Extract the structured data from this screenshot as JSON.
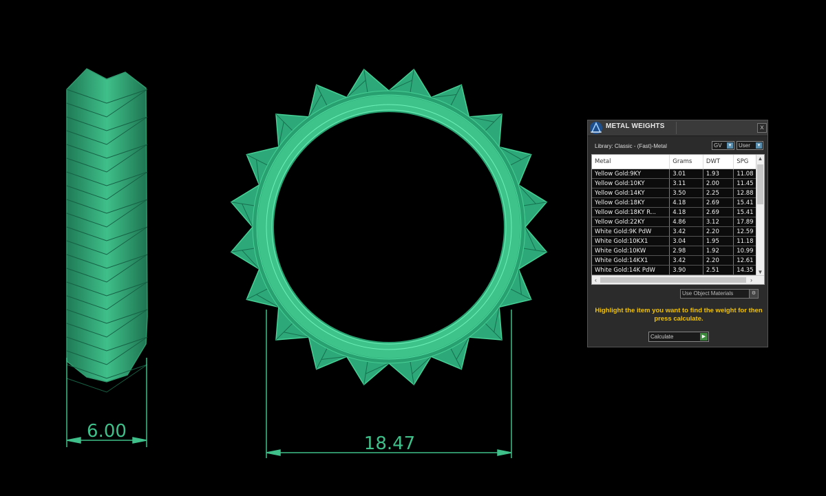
{
  "viewport": {
    "dimension_width_label": "6.00",
    "dimension_diameter_label": "18.47",
    "model_color": "#3fbf8a"
  },
  "panel": {
    "title": "METAL WEIGHTS",
    "close_label": "x",
    "library_label": "Library: Classic - (Fast)-Metal",
    "unit_select": "GV",
    "user_select": "User",
    "columns": [
      "Metal",
      "Grams",
      "DWT",
      "SPG"
    ],
    "rows": [
      [
        "Yellow Gold:9KY",
        "3.01",
        "1.93",
        "11.08"
      ],
      [
        "Yellow Gold:10KY",
        "3.11",
        "2.00",
        "11.45"
      ],
      [
        "Yellow Gold:14KY",
        "3.50",
        "2.25",
        "12.88"
      ],
      [
        "Yellow Gold:18KY",
        "4.18",
        "2.69",
        "15.41"
      ],
      [
        "Yellow Gold:18KY R...",
        "4.18",
        "2.69",
        "15.41"
      ],
      [
        "Yellow Gold:22KY",
        "4.86",
        "3.12",
        "17.89"
      ],
      [
        "White Gold:9K PdW",
        "3.42",
        "2.20",
        "12.59"
      ],
      [
        "White Gold:10KX1",
        "3.04",
        "1.95",
        "11.18"
      ],
      [
        "White Gold:10KW",
        "2.98",
        "1.92",
        "10.99"
      ],
      [
        "White Gold:14KX1",
        "3.42",
        "2.20",
        "12.61"
      ],
      [
        "White Gold:14K PdW",
        "3.90",
        "2.51",
        "14.35"
      ]
    ],
    "use_object_materials": "Use Object Materials",
    "instructions": "Highlight the item you want to find the weight for then press calculate.",
    "calculate_label": "Calculate",
    "accent_color": "#f2c200"
  }
}
